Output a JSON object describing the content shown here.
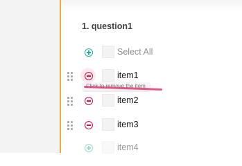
{
  "question": {
    "title": "1. question1"
  },
  "select_all": {
    "label": "Select All"
  },
  "items": [
    {
      "label": "item1"
    },
    {
      "label": "item2"
    },
    {
      "label": "item3"
    },
    {
      "label": "item4"
    }
  ],
  "tooltip": {
    "text": "Click to remove the item"
  },
  "colors": {
    "accent": "#f3a73a",
    "add": "#19b394",
    "remove": "#e60a3e",
    "underline": "#e0447a"
  }
}
